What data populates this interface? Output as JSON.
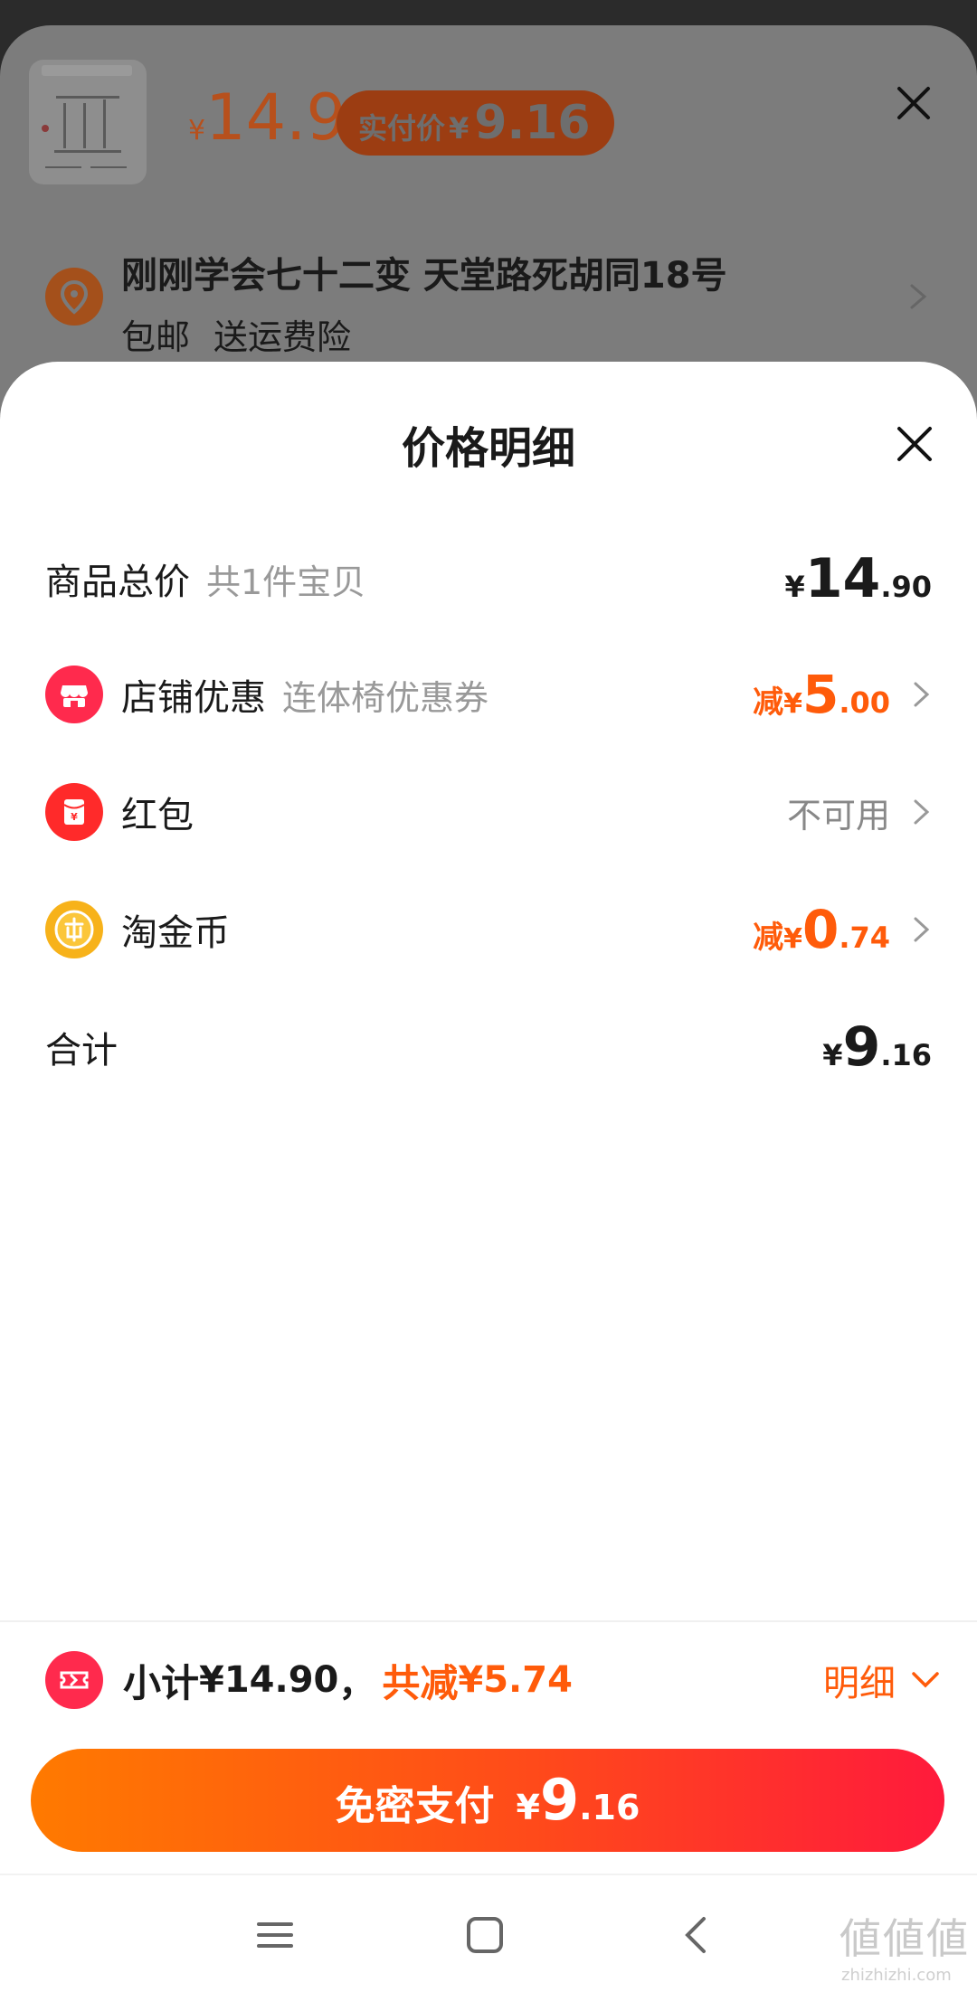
{
  "background": {
    "price_currency": "¥",
    "price": "14.9",
    "paid_label": "实付价",
    "paid_currency": "¥",
    "paid_price": "9.16",
    "address": "刚刚学会七十二变 天堂路死胡同18号",
    "shipping_tags": [
      "包邮",
      "送运费险"
    ]
  },
  "sheet": {
    "title": "价格明细",
    "rows": [
      {
        "label": "商品总价",
        "sub": "共1件宝贝",
        "currency": "¥",
        "int": "14",
        "dec": ".90"
      },
      {
        "label": "店铺优惠",
        "sub": "连体椅优惠券",
        "prefix": "减",
        "currency": "¥",
        "int": "5",
        "dec": ".00"
      },
      {
        "label": "红包",
        "status": "不可用"
      },
      {
        "label": "淘金币",
        "prefix": "减",
        "currency": "¥",
        "int": "0",
        "dec": ".74"
      },
      {
        "label": "合计",
        "currency": "¥",
        "int": "9",
        "dec": ".16"
      }
    ]
  },
  "summary": {
    "subtotal_label": "小计",
    "subtotal_value": "¥14.90",
    "comma": "，",
    "discount_label": "共减",
    "discount_value": "¥5.74",
    "detail_label": "明细"
  },
  "pay_button": {
    "label": "免密支付",
    "currency": "¥",
    "int": "9",
    "dec": ".16"
  },
  "watermark": {
    "text": "値値値",
    "sub": "zhizhizhi.com"
  },
  "colors": {
    "accent": "#ff5b0a",
    "red": "#ff2a4d",
    "gold": "#f7b21a"
  }
}
